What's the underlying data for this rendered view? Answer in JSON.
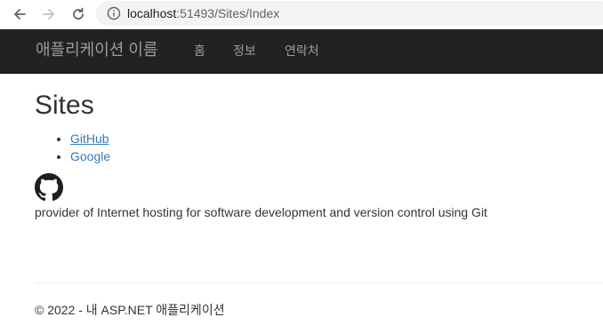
{
  "browser": {
    "url_host": "localhost",
    "url_path": ":51493/Sites/Index",
    "back_icon": "arrow-left-icon",
    "forward_icon": "arrow-right-icon",
    "reload_icon": "reload-icon",
    "info_icon": "info-icon"
  },
  "navbar": {
    "brand": "애플리케이션 이름",
    "links": [
      "홈",
      "정보",
      "연락처"
    ],
    "background": "#222222",
    "text_color": "#9d9d9d"
  },
  "main": {
    "title": "Sites",
    "sites": [
      {
        "label": "GitHub",
        "active": true
      },
      {
        "label": "Google",
        "active": false
      }
    ],
    "logo_icon": "github-icon",
    "description": "provider of Internet hosting for software development and version control using Git",
    "link_color": "#337ab7"
  },
  "footer": {
    "text": "© 2022 - 내 ASP.NET 애플리케이션"
  }
}
